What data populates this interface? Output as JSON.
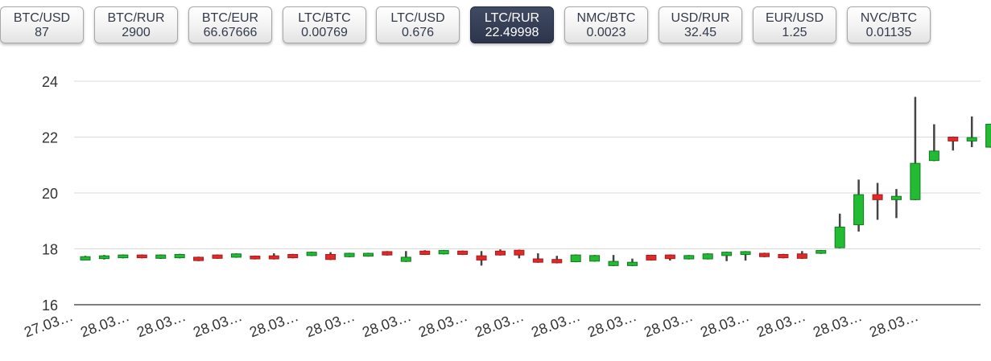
{
  "tabs": [
    {
      "pair": "BTC/USD",
      "value": "87",
      "active": false
    },
    {
      "pair": "BTC/RUR",
      "value": "2900",
      "active": false
    },
    {
      "pair": "BTC/EUR",
      "value": "66.67666",
      "active": false
    },
    {
      "pair": "LTC/BTC",
      "value": "0.00769",
      "active": false
    },
    {
      "pair": "LTC/USD",
      "value": "0.676",
      "active": false
    },
    {
      "pair": "LTC/RUR",
      "value": "22.49998",
      "active": true
    },
    {
      "pair": "NMC/BTC",
      "value": "0.0023",
      "active": false
    },
    {
      "pair": "USD/RUR",
      "value": "32.45",
      "active": false
    },
    {
      "pair": "EUR/USD",
      "value": "1.25",
      "active": false
    },
    {
      "pair": "NVC/BTC",
      "value": "0.01135",
      "active": false
    }
  ],
  "colors": {
    "up": "#22bb33",
    "down": "#e02a2a",
    "wick": "#444444",
    "grid": "#d9d9d9",
    "active_tab": "#2f3850"
  },
  "chart_data": {
    "type": "candlestick",
    "ylim": [
      16,
      24
    ],
    "y_ticks": [
      16,
      18,
      20,
      22,
      24
    ],
    "x_tick_labels": [
      "27.03…",
      "28.03…",
      "28.03…",
      "28.03…",
      "28.03…",
      "28.03…",
      "28.03…",
      "28.03…",
      "28.03…",
      "28.03…",
      "28.03…",
      "28.03…",
      "28.03…",
      "28.03…",
      "28.03…",
      "28.03…"
    ],
    "candles": [
      {
        "open": 17.6,
        "close": 17.72,
        "high": 17.75,
        "low": 17.6
      },
      {
        "open": 17.65,
        "close": 17.75,
        "high": 17.78,
        "low": 17.62
      },
      {
        "open": 17.68,
        "close": 17.78,
        "high": 17.8,
        "low": 17.66
      },
      {
        "open": 17.78,
        "close": 17.68,
        "high": 17.8,
        "low": 17.66
      },
      {
        "open": 17.66,
        "close": 17.78,
        "high": 17.8,
        "low": 17.64
      },
      {
        "open": 17.68,
        "close": 17.8,
        "high": 17.82,
        "low": 17.66
      },
      {
        "open": 17.7,
        "close": 17.58,
        "high": 17.72,
        "low": 17.56
      },
      {
        "open": 17.78,
        "close": 17.66,
        "high": 17.8,
        "low": 17.64
      },
      {
        "open": 17.7,
        "close": 17.82,
        "high": 17.84,
        "low": 17.68
      },
      {
        "open": 17.74,
        "close": 17.64,
        "high": 17.76,
        "low": 17.62
      },
      {
        "open": 17.75,
        "close": 17.64,
        "high": 17.84,
        "low": 17.62
      },
      {
        "open": 17.8,
        "close": 17.68,
        "high": 17.82,
        "low": 17.66
      },
      {
        "open": 17.76,
        "close": 17.88,
        "high": 17.9,
        "low": 17.74
      },
      {
        "open": 17.8,
        "close": 17.62,
        "high": 17.88,
        "low": 17.6
      },
      {
        "open": 17.72,
        "close": 17.84,
        "high": 17.86,
        "low": 17.7
      },
      {
        "open": 17.74,
        "close": 17.84,
        "high": 17.86,
        "low": 17.72
      },
      {
        "open": 17.9,
        "close": 17.78,
        "high": 17.92,
        "low": 17.76
      },
      {
        "open": 17.55,
        "close": 17.7,
        "high": 17.92,
        "low": 17.53
      },
      {
        "open": 17.92,
        "close": 17.8,
        "high": 17.95,
        "low": 17.78
      },
      {
        "open": 17.82,
        "close": 17.94,
        "high": 17.96,
        "low": 17.8
      },
      {
        "open": 17.92,
        "close": 17.8,
        "high": 17.94,
        "low": 17.78
      },
      {
        "open": 17.75,
        "close": 17.6,
        "high": 17.92,
        "low": 17.4
      },
      {
        "open": 17.92,
        "close": 17.78,
        "high": 17.98,
        "low": 17.76
      },
      {
        "open": 17.95,
        "close": 17.78,
        "high": 17.97,
        "low": 17.66
      },
      {
        "open": 17.64,
        "close": 17.52,
        "high": 17.84,
        "low": 17.5
      },
      {
        "open": 17.62,
        "close": 17.5,
        "high": 17.75,
        "low": 17.48
      },
      {
        "open": 17.54,
        "close": 17.78,
        "high": 17.8,
        "low": 17.52
      },
      {
        "open": 17.56,
        "close": 17.76,
        "high": 17.78,
        "low": 17.54
      },
      {
        "open": 17.4,
        "close": 17.55,
        "high": 17.78,
        "low": 17.38
      },
      {
        "open": 17.4,
        "close": 17.52,
        "high": 17.65,
        "low": 17.38
      },
      {
        "open": 17.77,
        "close": 17.6,
        "high": 17.79,
        "low": 17.58
      },
      {
        "open": 17.78,
        "close": 17.65,
        "high": 17.8,
        "low": 17.58
      },
      {
        "open": 17.64,
        "close": 17.76,
        "high": 17.78,
        "low": 17.62
      },
      {
        "open": 17.64,
        "close": 17.82,
        "high": 17.84,
        "low": 17.62
      },
      {
        "open": 17.76,
        "close": 17.88,
        "high": 17.9,
        "low": 17.56
      },
      {
        "open": 17.8,
        "close": 17.9,
        "high": 17.92,
        "low": 17.58
      },
      {
        "open": 17.84,
        "close": 17.72,
        "high": 17.86,
        "low": 17.7
      },
      {
        "open": 17.8,
        "close": 17.68,
        "high": 17.82,
        "low": 17.66
      },
      {
        "open": 17.82,
        "close": 17.66,
        "high": 17.92,
        "low": 17.64
      },
      {
        "open": 17.84,
        "close": 17.94,
        "high": 17.96,
        "low": 17.82
      },
      {
        "open": 18.04,
        "close": 18.78,
        "high": 19.26,
        "low": 18.02
      },
      {
        "open": 18.86,
        "close": 19.94,
        "high": 20.48,
        "low": 18.62
      },
      {
        "open": 19.94,
        "close": 19.76,
        "high": 20.36,
        "low": 19.04
      },
      {
        "open": 19.76,
        "close": 19.88,
        "high": 20.14,
        "low": 19.1
      },
      {
        "open": 19.76,
        "close": 21.06,
        "high": 23.44,
        "low": 19.74
      },
      {
        "open": 21.16,
        "close": 21.5,
        "high": 22.46,
        "low": 21.14
      },
      {
        "open": 22.0,
        "close": 21.86,
        "high": 22.02,
        "low": 21.52
      },
      {
        "open": 21.86,
        "close": 21.98,
        "high": 22.74,
        "low": 21.64
      },
      {
        "open": 21.64,
        "close": 22.46,
        "high": 22.48,
        "low": 21.62
      }
    ]
  }
}
